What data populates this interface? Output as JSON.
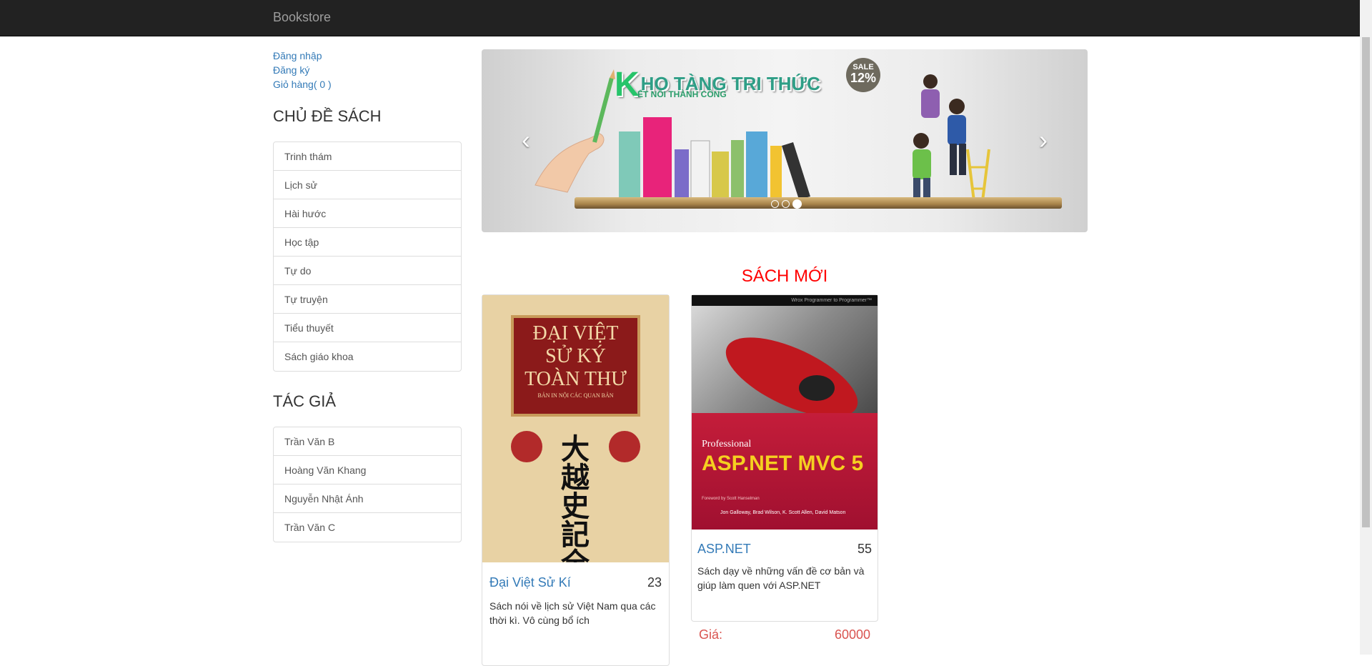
{
  "navbar": {
    "brand": "Bookstore"
  },
  "user_links": {
    "login": "Đăng nhập",
    "register": "Đăng ký",
    "cart": "Giỏ hàng( 0 )"
  },
  "categories": {
    "title": "CHỦ ĐỀ SÁCH",
    "items": [
      "Trinh thám",
      "Lịch sử",
      "Hài hước",
      "Học tập",
      "Tự do",
      "Tự truyện",
      "Tiểu thuyết",
      "Sách giáo khoa"
    ]
  },
  "authors": {
    "title": "TÁC GIẢ",
    "items": [
      "Trần Văn B",
      "Hoàng Văn Khang",
      "Nguyễn Nhật Ánh",
      "Trần Văn C"
    ]
  },
  "carousel": {
    "banner_title": "HO TÀNG TRI THỨC",
    "banner_k": "K",
    "banner_sub": "ẾT NỐI THÀNH CÔNG",
    "sale_label": "SALE",
    "sale_value": "12%",
    "active_slide": 3,
    "slide_count": 3
  },
  "new_books": {
    "title": "SÁCH MỚI",
    "books": [
      {
        "title": "Đại Việt Sử Kí",
        "quantity": "23",
        "description": "Sách nói về lịch sử Việt Nam qua các thời kì. Vô cùng bổ ích",
        "cover_text_1": "ĐẠI VIỆT",
        "cover_text_2": "SỬ KÝ",
        "cover_text_3": "TOÀN THƯ",
        "cover_sub": "BẢN IN NỘI CÁC QUAN BẢN",
        "cover_chinese": "大越史記全書"
      },
      {
        "title": "ASP.NET",
        "quantity": "55",
        "description": "Sách dạy về những vấn đề cơ bản và giúp làm quen với ASP.NET",
        "price_label": "Giá:",
        "price_value": "60000",
        "cover_text_1": "Professional",
        "cover_text_2": "ASP.NET MVC 5",
        "cover_authors": "Jon Galloway, Brad Wilson, K. Scott Allen, David Matson",
        "cover_foreword": "Foreword by Scott Hanselman",
        "cover_series": "Wrox Programmer to Programmer™"
      }
    ]
  }
}
